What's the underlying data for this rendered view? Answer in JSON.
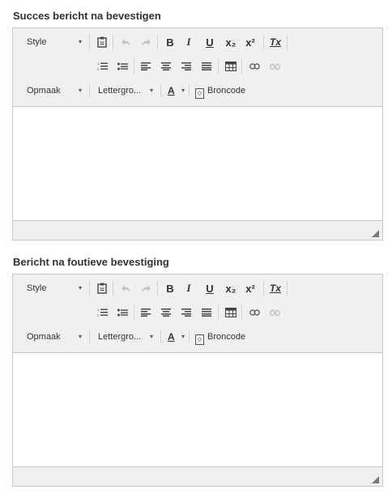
{
  "fields": [
    {
      "label": "Succes bericht na bevestigen",
      "toolbar": {
        "style_label": "Style",
        "format_label": "Opmaak",
        "fontsize_label": "Lettergro...",
        "font_color_label": "A",
        "source_label": "Broncode"
      }
    },
    {
      "label": "Bericht na foutieve bevestiging",
      "toolbar": {
        "style_label": "Style",
        "format_label": "Opmaak",
        "fontsize_label": "Lettergro...",
        "font_color_label": "A",
        "source_label": "Broncode"
      }
    }
  ],
  "icons": {
    "paste": "clipboard-icon",
    "undo": "undo-icon",
    "redo": "redo-icon",
    "bold": "B",
    "italic": "I",
    "underline": "U",
    "subscript": "x₂",
    "superscript": "x²",
    "remove_format": "Tx",
    "numbered_list": "ordered-list-icon",
    "bulleted_list": "unordered-list-icon",
    "align_left": "align-left-icon",
    "align_center": "align-center-icon",
    "align_right": "align-right-icon",
    "justify": "justify-icon",
    "table": "table-icon",
    "link": "link-icon",
    "unlink": "unlink-icon"
  },
  "colors": {
    "toolbar_bg": "#f0f0f0",
    "border": "#c8c8c8",
    "disabled": "#b8b8b8"
  }
}
